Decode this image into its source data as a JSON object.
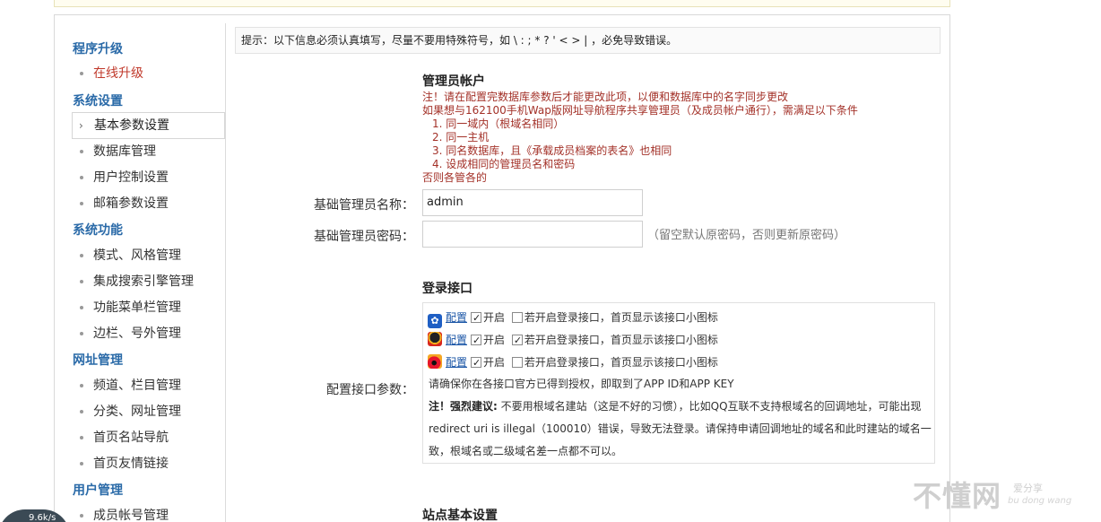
{
  "sidebar": {
    "groups": [
      {
        "title": "程序升级",
        "items": [
          {
            "label": "在线升级"
          }
        ]
      },
      {
        "title": "系统设置",
        "items": [
          {
            "label": "基本参数设置"
          },
          {
            "label": "数据库管理"
          },
          {
            "label": "用户控制设置"
          },
          {
            "label": "邮箱参数设置"
          }
        ]
      },
      {
        "title": "系统功能",
        "items": [
          {
            "label": "模式、风格管理"
          },
          {
            "label": "集成搜索引擎管理"
          },
          {
            "label": "功能菜单栏管理"
          },
          {
            "label": "边栏、号外管理"
          }
        ]
      },
      {
        "title": "网址管理",
        "items": [
          {
            "label": "频道、栏目管理"
          },
          {
            "label": "分类、网址管理"
          },
          {
            "label": "首页名站导航"
          },
          {
            "label": "首页友情链接"
          }
        ]
      },
      {
        "title": "用户管理",
        "items": [
          {
            "label": "成员帐号管理"
          }
        ]
      }
    ]
  },
  "tip": "提示：以下信息必须认真填写，尽量不要用特殊符号，如 \\ : ; * ? ' < > | ，必免导致错误。",
  "admin_section": {
    "title": "管理员帐户",
    "warn1": "注！请在配置完数据库参数后才能更改此项，以便和数据库中的名字同步更改",
    "warn2": "如果想与162100手机Wap版网址导航程序共享管理员（及成员帐户通行），需满足以下条件",
    "conditions": [
      "1. 同一域内（根域名相同）",
      "2. 同一主机",
      "3. 同名数据库，且《承载成员档案的表名》也相同",
      "4. 设成相同的管理员名和密码"
    ],
    "warn3": "否则各管各的",
    "name_label": "基础管理员名称：",
    "name_value": "admin",
    "pwd_label": "基础管理员密码：",
    "pwd_hint": "（留空默认原密码，否则更新原密码）"
  },
  "login_section": {
    "title": "登录接口",
    "label": "配置接口参数：",
    "providers": [
      {
        "icon": "baidu-paw-icon",
        "config": "配置",
        "enabled": true,
        "show_icon": false
      },
      {
        "icon": "qq-penguin-icon",
        "config": "配置",
        "enabled": true,
        "show_icon": true
      },
      {
        "icon": "weibo-icon",
        "config": "配置",
        "enabled": true,
        "show_icon": false
      }
    ],
    "enable_text": "开启",
    "show_text": "若开启登录接口，首页显示该接口小图标",
    "line1": "请确保你在各接口官方已得到授权，即取到了APP ID和APP KEY",
    "line2_bold": "注！强烈建议:",
    "line2": " 不要用根域名建站（这是不好的习惯），比如QQ互联不支持根域名的回调地址，可能出现",
    "line3": "redirect uri is illegal（100010）错误，导致无法登录。请保持申请回调地址的域名和此时建站的域名一",
    "line4": "致，根域名或二级域名差一点都不可以。"
  },
  "site_section": {
    "title": "站点基本设置"
  },
  "watermark": {
    "main": "不懂网",
    "sub1": "爱分享",
    "sub2": "bu dong wang"
  },
  "corner_badge": "9.6k/s",
  "colors": {
    "category": "#2a6aa8",
    "warning": "#a33128",
    "link": "#1a55a6"
  }
}
